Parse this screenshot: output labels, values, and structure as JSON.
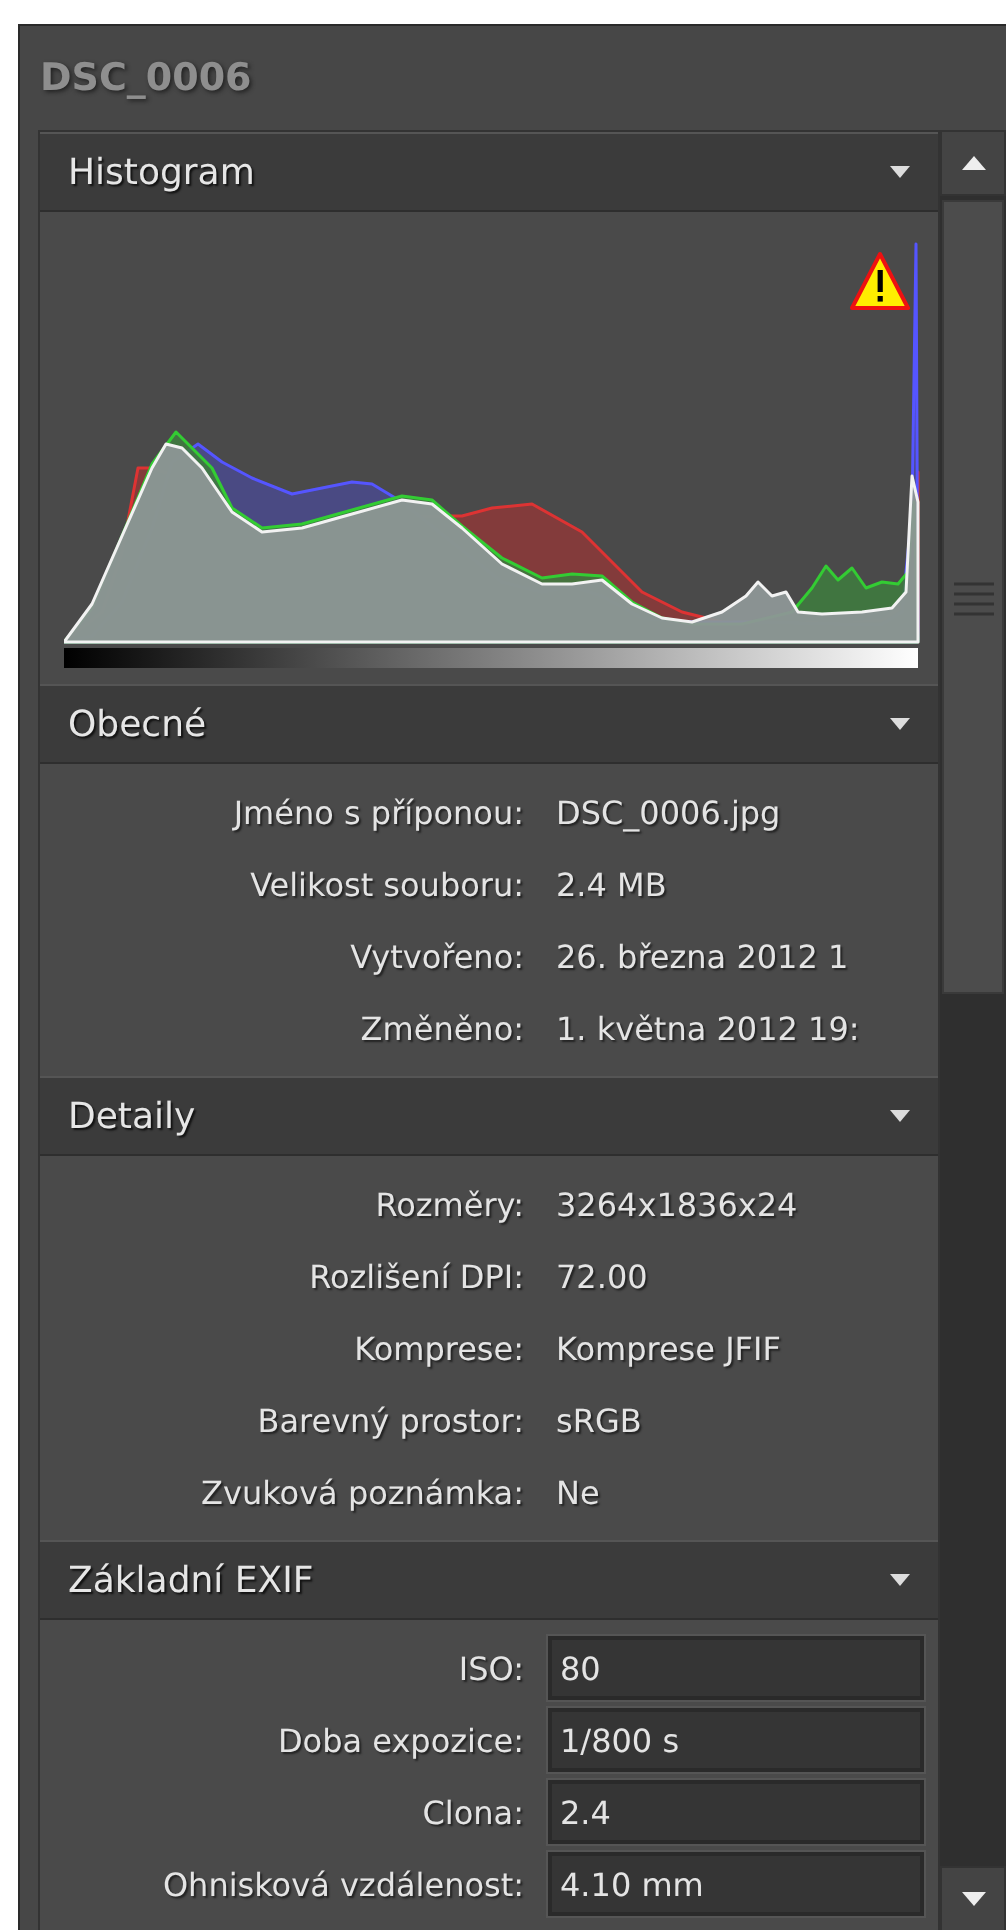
{
  "title": "DSC_0006",
  "sections": [
    {
      "kind": "histogram",
      "title": "Histogram",
      "expanded": true,
      "clipping_warning": true
    },
    {
      "kind": "properties",
      "title": "Obecné",
      "expanded": true,
      "rows": [
        {
          "label": "Jméno s příponou:",
          "value": "DSC_0006.jpg"
        },
        {
          "label": "Velikost souboru:",
          "value": "2.4 MB"
        },
        {
          "label": "Vytvořeno:",
          "value": "26. března 2012 1"
        },
        {
          "label": "Změněno:",
          "value": "1. května 2012 19:"
        }
      ]
    },
    {
      "kind": "properties",
      "title": "Detaily",
      "expanded": true,
      "rows": [
        {
          "label": "Rozměry:",
          "value": "3264x1836x24"
        },
        {
          "label": "Rozlišení DPI:",
          "value": "72.00"
        },
        {
          "label": "Komprese:",
          "value": "Komprese JFIF"
        },
        {
          "label": "Barevný prostor:",
          "value": "sRGB"
        },
        {
          "label": "Zvuková poznámka:",
          "value": "Ne"
        }
      ]
    },
    {
      "kind": "fields",
      "title": "Základní EXIF",
      "expanded": true,
      "rows": [
        {
          "label": "ISO:",
          "value": "80"
        },
        {
          "label": "Doba expozice:",
          "value": "1/800 s"
        },
        {
          "label": "Clona:",
          "value": "2.4"
        },
        {
          "label": "Ohnisková vzdálenost:",
          "value": "4.10 mm"
        }
      ]
    }
  ]
}
